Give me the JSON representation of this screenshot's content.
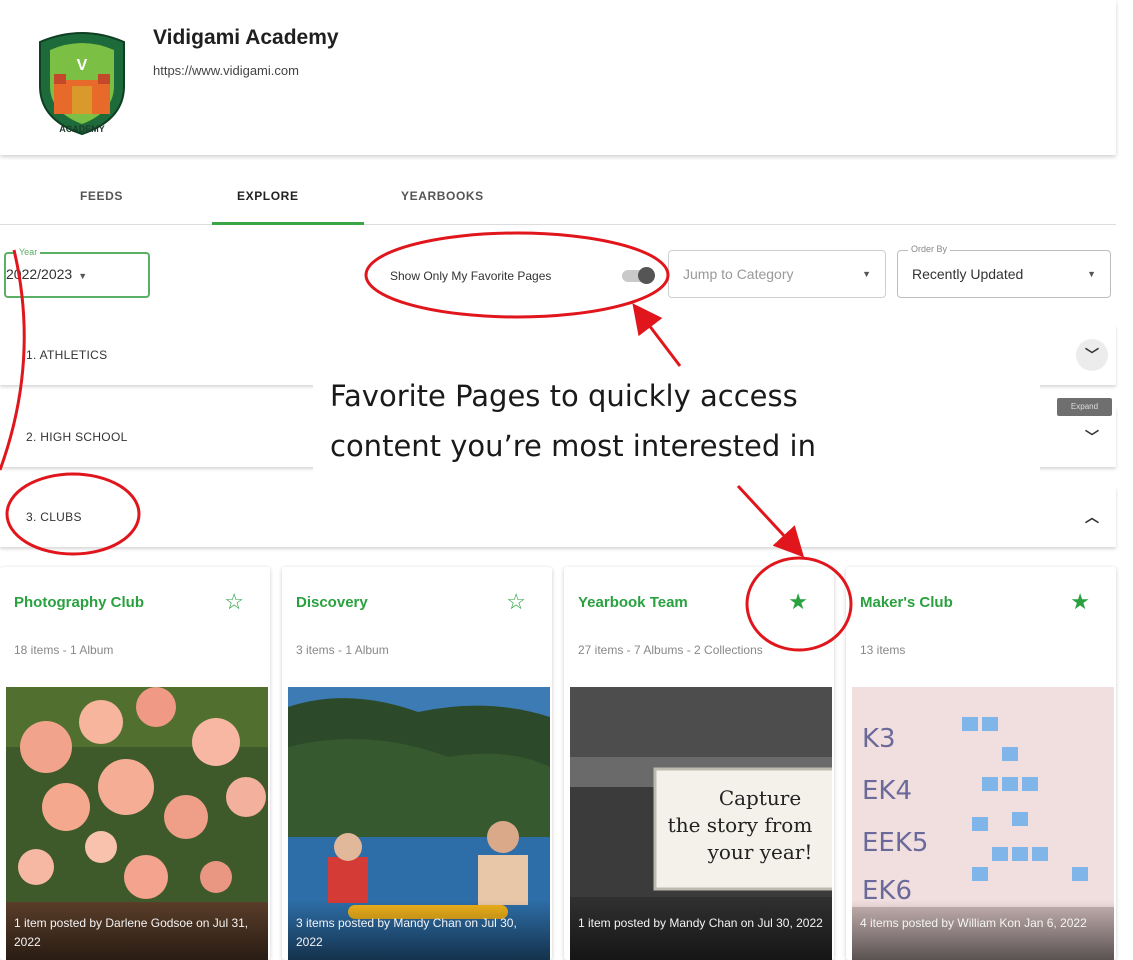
{
  "header": {
    "school_name": "Vidigami Academy",
    "url": "https://www.vidigami.com",
    "logo_letter": "V",
    "logo_text": "ACADEMY"
  },
  "tabs": [
    {
      "label": "FEEDS",
      "active": false
    },
    {
      "label": "EXPLORE",
      "active": true
    },
    {
      "label": "YEARBOOKS",
      "active": false
    }
  ],
  "filters": {
    "year_legend": "Year",
    "year_value": "2022/2023",
    "favorite_toggle_label": "Show Only My Favorite Pages",
    "favorite_toggle_on": false,
    "category_placeholder": "Jump to Category",
    "order_legend": "Order By",
    "order_value": "Recently Updated"
  },
  "categories": [
    {
      "label": "1. ATHLETICS",
      "expanded": false
    },
    {
      "label": "2. HIGH SCHOOL",
      "expanded": false
    },
    {
      "label": "3. CLUBS",
      "expanded": true
    }
  ],
  "expand_tooltip": "Expand",
  "cards": [
    {
      "title": "Photography Club",
      "favorite": false,
      "meta": "18 items - 1 Album",
      "caption": "1 item posted by Darlene Godsoe on Jul 31, 2022"
    },
    {
      "title": "Discovery",
      "favorite": false,
      "meta": "3 items - 1 Album",
      "caption": "3 items posted by Mandy Chan on Jul 30, 2022"
    },
    {
      "title": "Yearbook Team",
      "favorite": true,
      "meta": "27 items - 7 Albums - 2 Collections",
      "caption": "1 item posted by Mandy Chan on Jul 30, 2022",
      "image_text": [
        "Capture",
        "the story from",
        "your year!"
      ]
    },
    {
      "title": "Maker's Club",
      "favorite": true,
      "meta": "13 items",
      "caption": "4 items posted by William Kon Jan 6, 2022"
    }
  ],
  "annotation": {
    "line1": "Favorite Pages to quickly access",
    "line2": "content you’re most interested in"
  },
  "colors": {
    "accent_green": "#2aa13f",
    "annotation_red": "#e0161c"
  },
  "icons": {
    "star_filled": "★",
    "star_outline": "☆",
    "chevron_down": "⌄",
    "chevron_up": "⌃"
  }
}
